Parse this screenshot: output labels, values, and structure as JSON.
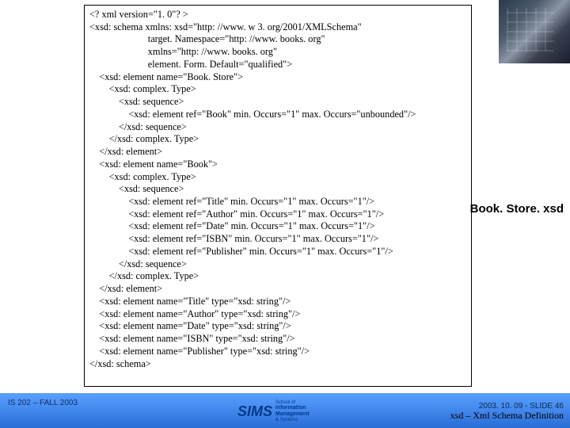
{
  "code_lines": [
    "<? xml version=\"1. 0\"? >",
    "<xsd: schema xmlns: xsd=\"http: //www. w 3. org/2001/XMLSchema\"",
    "                        target. Namespace=\"http: //www. books. org\"",
    "                        xmlns=\"http: //www. books. org\"",
    "                        element. Form. Default=\"qualified\">",
    "    <xsd: element name=\"Book. Store\">",
    "        <xsd: complex. Type>",
    "            <xsd: sequence>",
    "                <xsd: element ref=\"Book\" min. Occurs=\"1\" max. Occurs=\"unbounded\"/>",
    "            </xsd: sequence>",
    "        </xsd: complex. Type>",
    "    </xsd: element>",
    "    <xsd: element name=\"Book\">",
    "        <xsd: complex. Type>",
    "            <xsd: sequence>",
    "                <xsd: element ref=\"Title\" min. Occurs=\"1\" max. Occurs=\"1\"/>",
    "                <xsd: element ref=\"Author\" min. Occurs=\"1\" max. Occurs=\"1\"/>",
    "                <xsd: element ref=\"Date\" min. Occurs=\"1\" max. Occurs=\"1\"/>",
    "                <xsd: element ref=\"ISBN\" min. Occurs=\"1\" max. Occurs=\"1\"/>",
    "                <xsd: element ref=\"Publisher\" min. Occurs=\"1\" max. Occurs=\"1\"/>",
    "            </xsd: sequence>",
    "        </xsd: complex. Type>",
    "    </xsd: element>",
    "    <xsd: element name=\"Title\" type=\"xsd: string\"/>",
    "    <xsd: element name=\"Author\" type=\"xsd: string\"/>",
    "    <xsd: element name=\"Date\" type=\"xsd: string\"/>",
    "    <xsd: element name=\"ISBN\" type=\"xsd: string\"/>",
    "    <xsd: element name=\"Publisher\" type=\"xsd: string\"/>",
    "</xsd: schema>"
  ],
  "side_label": "Book. Store. xsd",
  "footer": {
    "left": "IS 202 – FALL 2003",
    "right_top": "2003. 10. 09 - SLIDE 46",
    "right_bottom": "xsd – Xml Schema Definition"
  },
  "logo": {
    "main": "SIMS",
    "sub1": "School of",
    "sub2": "Information",
    "sub3": "Management",
    "sub4": "& Systems"
  }
}
